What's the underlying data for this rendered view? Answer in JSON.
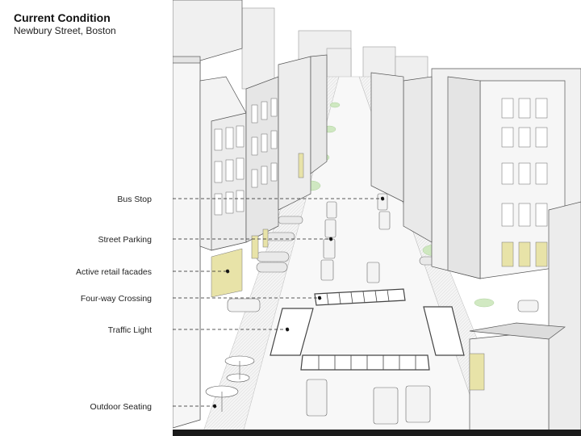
{
  "header": {
    "title": "Current Condition",
    "subtitle": "Newbury Street, Boston"
  },
  "callouts": [
    {
      "id": "bus-stop",
      "label": "Bus Stop"
    },
    {
      "id": "street-parking",
      "label": "Street Parking"
    },
    {
      "id": "active-retail-facades",
      "label": "Active retail facades"
    },
    {
      "id": "four-way-crossing",
      "label": "Four-way Crossing"
    },
    {
      "id": "traffic-light",
      "label": "Traffic Light"
    },
    {
      "id": "outdoor-seating",
      "label": "Outdoor Seating"
    }
  ],
  "colors": {
    "building": "#f2f2f2",
    "building_shade": "#d9d9d9",
    "window": "#e6e6e6",
    "retail_facade": "#e8e3a8",
    "greenery": "#b9dca8",
    "street": "#f7f7f7",
    "outline": "#555555"
  }
}
